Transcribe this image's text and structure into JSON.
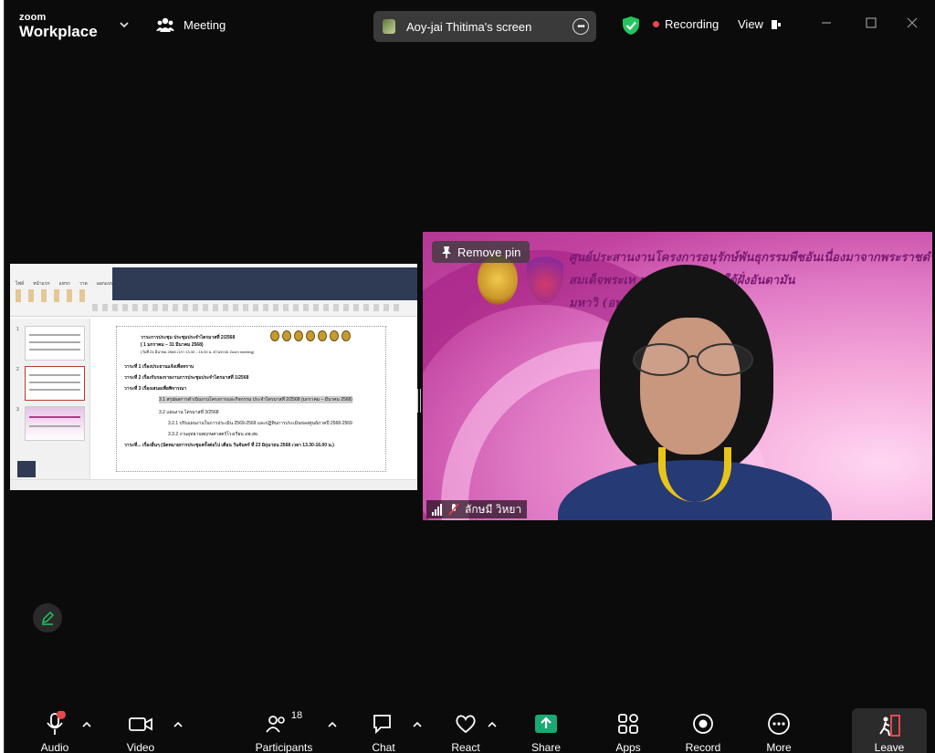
{
  "app": {
    "brand_top": "zoom",
    "brand_bottom": "Workplace"
  },
  "header": {
    "meeting_label": "Meeting",
    "screen_share_label": "Aoy-jai Thitima's screen",
    "recording_label": "Recording",
    "view_label": "View"
  },
  "video": {
    "remove_pin_label": "Remove pin",
    "participant_name": "ลักษมี วิหยา",
    "banner_lines": [
      "ศูนย์ประสานงานโครงการอนุรักษ์พันธุกรรมพืชอันเนื่องมาจากพระราชดำริ",
      "สมเด็จพระเท                        นราชกุมารี ภาคใต้ฝั่งอันดามัน",
      "มหาวิ                                  (อพ.สธ.-มทร.ศรีวิชัย)"
    ]
  },
  "shared_slide": {
    "ribbon_tabs": [
      "ไฟล์",
      "หน้าแรก",
      "แทรก",
      "วาด",
      "ออกแบบ"
    ],
    "thumb_numbers": [
      "1",
      "2",
      "3"
    ],
    "lines": [
      "วาระการประชุม ประชุมประจำไตรมาสที่ 2/2568",
      "( 1 มกราคม – 31 มีนาคม 2568)",
      "(วันที่ 24 มีนาคม 2568 เวลา 13.30 – 16.00 น. ผ่านระบบ Zoom meeting)",
      "วาระที่ 1 เรื่องประธานแจ้งเพื่อทราบ",
      "วาระที่ 2 เรื่องรับรองรายงานการประชุมประจำไตรมาสที่ 1/2568",
      "วาระที่ 3 เรื่องเสนอเพื่อพิจารณา",
      "3.1 สรุปผลการดำเนินงานโครงการและกิจกรรม ประจำไตรมาสที่ 2/2568 (มกราคม – มีนาคม 2568)",
      "3.2 แผนงาน ไตรมาสที่ 3/2568",
      "3.2.1 ปรับแผนงานในการประเมิน 2569-2569 และปฏิทินการประเมินของศูนย์ภาคปี 2568-2569",
      "3.3.2 งานอุทยานพฤกษศาสตร์โรงเรียน อพ.สธ.",
      "วาระที่... เรื่องอื่นๆ (นัดหมายการประชุมครั้งต่อไป เดือน วันจันทร์ ที่ 23 มิถุนายน 2568 เวลา 13.30-16.00 น.)"
    ]
  },
  "toolbar": {
    "audio_label": "Audio",
    "video_label": "Video",
    "participants_label": "Participants",
    "participants_count": "18",
    "chat_label": "Chat",
    "react_label": "React",
    "share_label": "Share",
    "apps_label": "Apps",
    "record_label": "Record",
    "more_label": "More",
    "leave_label": "Leave"
  },
  "colors": {
    "background": "#0b0b0b",
    "share_accent": "#19a974",
    "recording_dot": "#e5484d",
    "shield": "#22c55e",
    "leave_icon": "#e5484d"
  },
  "icons": [
    "chevron-down-icon",
    "meeting-people-icon",
    "more-icon",
    "shield-icon",
    "record-dot-icon",
    "view-icon",
    "minimize-icon",
    "maximize-icon",
    "close-icon",
    "pin-icon",
    "signal-icon",
    "mic-off-icon",
    "pencil-icon",
    "mic-icon",
    "camera-icon",
    "participants-icon",
    "chat-icon",
    "heart-icon",
    "share-arrow-icon",
    "apps-icon",
    "record-icon",
    "more-icon",
    "leave-icon"
  ]
}
